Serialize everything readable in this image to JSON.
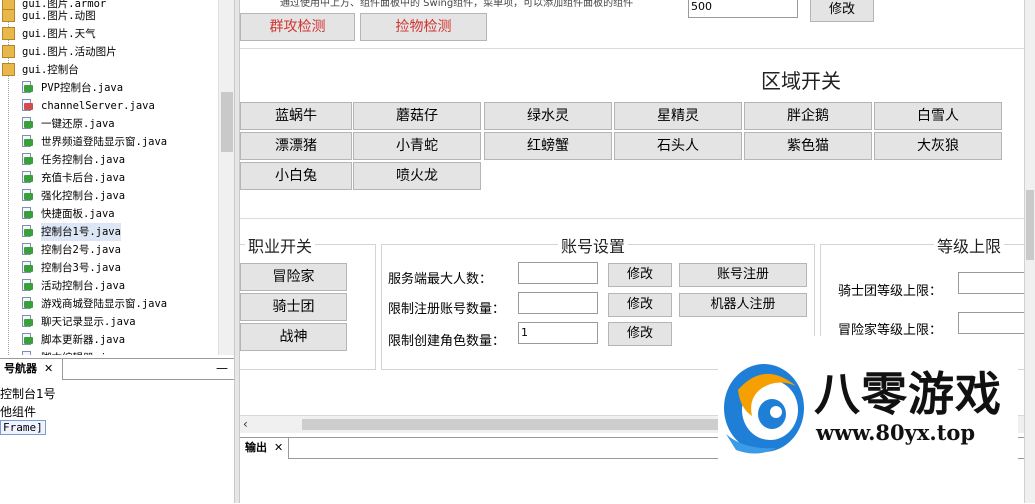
{
  "tree": {
    "packages": [
      "gui.图片.armor",
      "gui.图片.动图",
      "gui.图片.天气",
      "gui.图片.活动图片",
      "gui.控制台"
    ],
    "files": [
      {
        "label": "PVP控制台.java",
        "mark": "green"
      },
      {
        "label": "channelServer.java",
        "mark": "red"
      },
      {
        "label": "一键还原.java",
        "mark": "green"
      },
      {
        "label": "世界频道登陆显示窗.java",
        "mark": "green"
      },
      {
        "label": "任务控制台.java",
        "mark": "green"
      },
      {
        "label": "充值卡后台.java",
        "mark": "green"
      },
      {
        "label": "强化控制台.java",
        "mark": "green"
      },
      {
        "label": "快捷面板.java",
        "mark": "green"
      },
      {
        "label": "控制台1号.java",
        "mark": "green"
      },
      {
        "label": "控制台2号.java",
        "mark": "green"
      },
      {
        "label": "控制台3号.java",
        "mark": "green"
      },
      {
        "label": "活动控制台.java",
        "mark": "green"
      },
      {
        "label": "游戏商城登陆显示窗.java",
        "mark": "green"
      },
      {
        "label": "聊天记录显示.java",
        "mark": "green"
      },
      {
        "label": "脚本更新器.java",
        "mark": "green"
      },
      {
        "label": "脚本编辑器.java",
        "mark": "green"
      }
    ]
  },
  "navigator": {
    "tab_label": "号航器",
    "close": "✕",
    "minimize": "—",
    "line1": "控制台1号",
    "line2": "他组件",
    "line3": "Frame]"
  },
  "design": {
    "top_text": "通过使用中上方、组件面板中的 Swing组件，菜单项，可以添加组件面板的组件",
    "top_input_value": "500",
    "top_button": "修改",
    "buttons_top": [
      "群攻检测",
      "捡物检测"
    ],
    "zone_heading": "区域开关",
    "zones": [
      [
        "蓝蜗牛",
        "蘑菇仔",
        "绿水灵",
        "星精灵",
        "胖企鹅",
        "白雪人"
      ],
      [
        "漂漂猪",
        "小青蛇",
        "红螃蟹",
        "石头人",
        "紫色猫",
        "大灰狼"
      ],
      [
        "小白兔",
        "喷火龙"
      ]
    ],
    "job": {
      "heading": "职业开关",
      "buttons": [
        "冒险家",
        "骑士团",
        "战神"
      ]
    },
    "account": {
      "heading": "账号设置",
      "rows": [
        {
          "label": "服务端最大人数：",
          "value": "",
          "button": "修改"
        },
        {
          "label": "限制注册账号数量：",
          "value": "",
          "button": "修改"
        },
        {
          "label": "限制创建角色数量：",
          "value": "1",
          "button": "修改"
        }
      ],
      "side_buttons": [
        "账号注册",
        "机器人注册"
      ]
    },
    "level": {
      "heading": "等级上限",
      "rows": [
        {
          "label": "骑士团等级上限：",
          "value": ""
        },
        {
          "label": "冒险家等级上限：",
          "value": ""
        }
      ]
    }
  },
  "output": {
    "tab_label": "输出",
    "close": "✕"
  },
  "watermark": {
    "title": "八零游戏",
    "url": "www.80yx.top"
  },
  "colors": {
    "button_bg": "#e4e4e4",
    "red_text": "#d2332f",
    "logo_blue": "#1f7fd6",
    "logo_orange": "#f5a000"
  }
}
